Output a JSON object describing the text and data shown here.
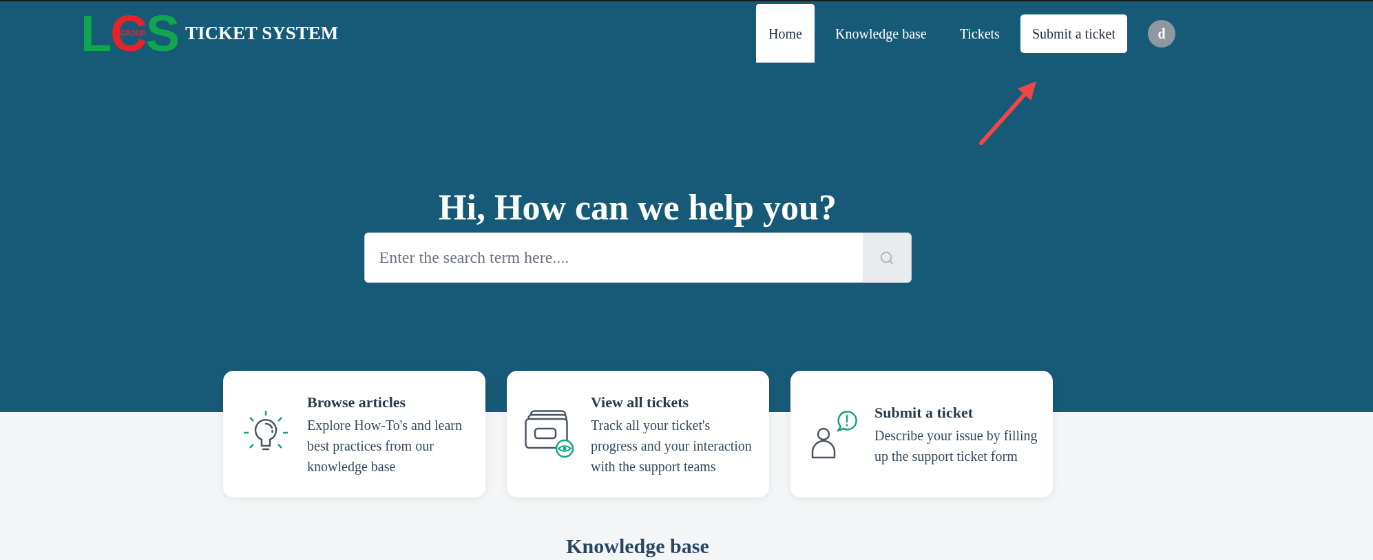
{
  "header": {
    "logo": {
      "wordmark": "LCS",
      "tagline": "GROUP"
    },
    "title": "TICKET SYSTEM",
    "nav": [
      {
        "label": "Home",
        "selected": true
      },
      {
        "label": "Knowledge base",
        "selected": false
      },
      {
        "label": "Tickets",
        "selected": false
      }
    ],
    "cta_button": "Submit a ticket",
    "avatar_initial": "d"
  },
  "hero": {
    "heading": "Hi, How can we help you?",
    "search": {
      "placeholder": "Enter the search term here...."
    }
  },
  "cards": [
    {
      "title": "Browse articles",
      "description": "Explore How-To's and learn best practices from our knowledge base"
    },
    {
      "title": "View all tickets",
      "description": "Track all your ticket's progress and your interaction with the support teams"
    },
    {
      "title": "Submit a ticket",
      "description": "Describe your issue by filling up the support ticket form"
    }
  ],
  "section_heading": "Knowledge base"
}
